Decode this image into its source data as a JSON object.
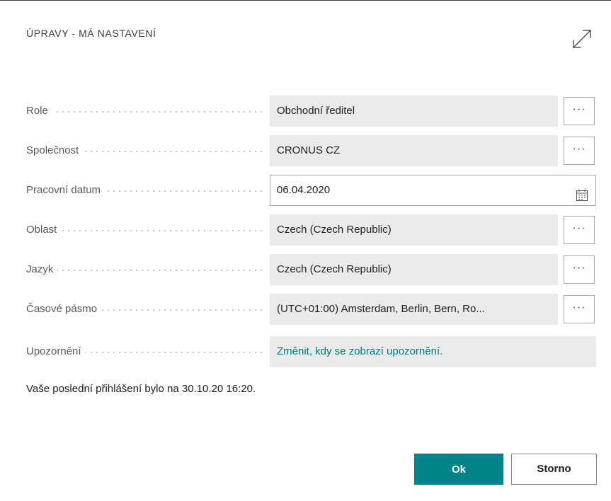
{
  "dialog": {
    "title": "ÚPRAVY - MÁ NASTAVENÍ",
    "expand_icon": "expand-arrows-icon"
  },
  "fields": [
    {
      "label": "Role",
      "value": "Obchodní ředitel",
      "assist": "···"
    },
    {
      "label": "Společnost",
      "value": "CRONUS CZ",
      "assist": "···"
    },
    {
      "label": "Pracovní datum",
      "value": "06.04.2020",
      "icon": "calendar-icon"
    },
    {
      "label": "Oblast",
      "value": "Czech (Czech Republic)",
      "assist": "···"
    },
    {
      "label": "Jazyk",
      "value": "Czech (Czech Republic)",
      "assist": "···"
    },
    {
      "label": "Časové pásmo",
      "value": "(UTC+01:00) Amsterdam, Berlin, Bern, Ro...",
      "assist": "···"
    },
    {
      "label": "Upozornění",
      "value": "Změnit, kdy se zobrazí upozornění."
    }
  ],
  "last_login": "Vaše poslední přihlášení bylo na 30.10.20 16:20.",
  "buttons": {
    "ok": "Ok",
    "cancel": "Storno"
  },
  "colors": {
    "accent": "#008489",
    "link": "#007a7a",
    "field_bg": "#eaeaea"
  }
}
